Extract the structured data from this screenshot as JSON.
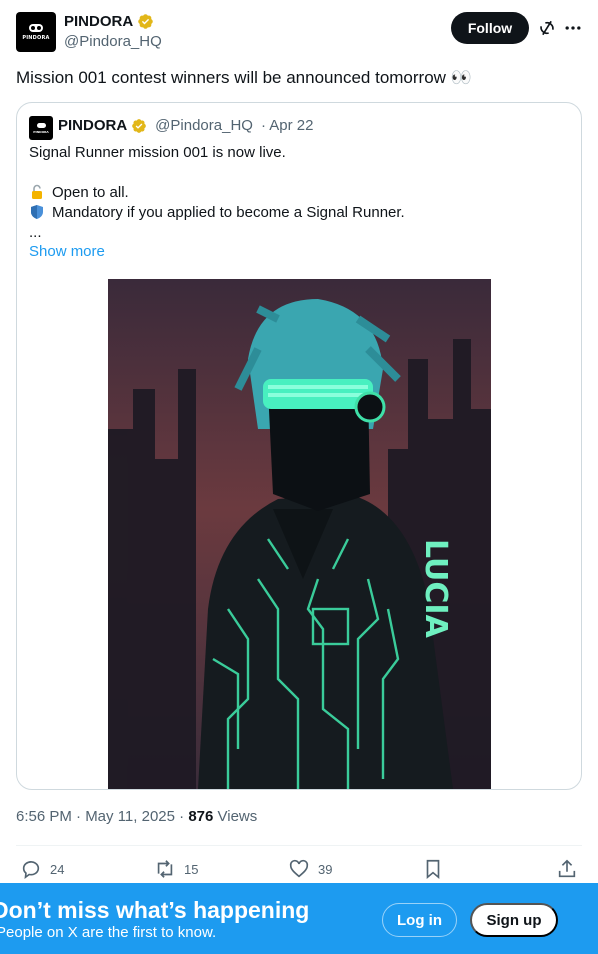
{
  "author": {
    "name": "PINDORA",
    "handle": "@Pindora_HQ",
    "avatar_text": "PINDORA",
    "verified": true
  },
  "header": {
    "follow_label": "Follow",
    "icons": [
      "grok-icon",
      "more-icon"
    ]
  },
  "tweet": {
    "text": "Mission 001 contest winners will be announced tomorrow 👀"
  },
  "quote": {
    "name": "PINDORA",
    "handle": "@Pindora_HQ",
    "date": "· Apr 22",
    "line1": "Signal Runner mission 001 is now live.",
    "line2": "Open to all.",
    "line3": "Mandatory if you applied to become a Signal Runner.",
    "ellipsis": "...",
    "show_more": "Show more",
    "image_text": "LUCIA"
  },
  "meta": {
    "time": "6:56 PM · May 11, 2025 · ",
    "views_count": "876",
    "views_label": " Views"
  },
  "actions": {
    "replies": "24",
    "reposts": "15",
    "likes": "39"
  },
  "banner": {
    "title": "Don’t miss what’s happening",
    "subtitle": "People on X are the first to know.",
    "login": "Log in",
    "signup": "Sign up"
  },
  "colors": {
    "accent": "#1d9bf0",
    "verified_gold": "#e2b719",
    "text": "#0f1419",
    "muted": "#536471"
  }
}
